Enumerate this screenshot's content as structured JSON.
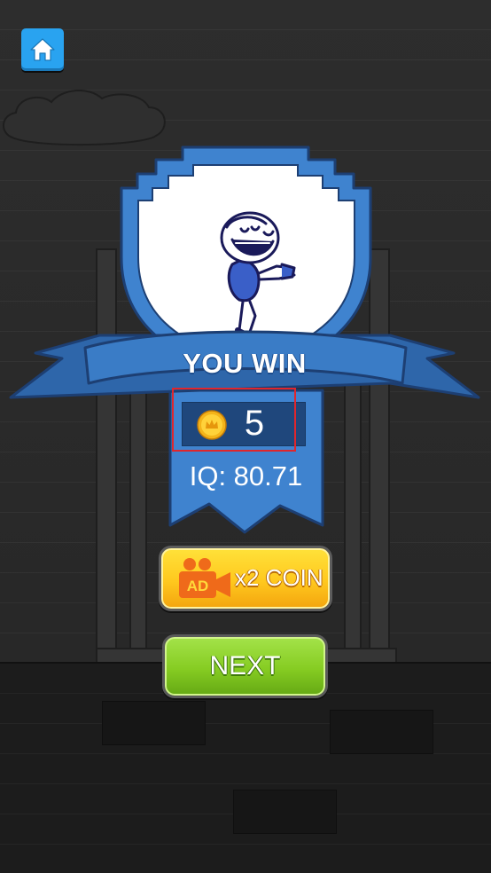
{
  "result": {
    "title": "YOU WIN",
    "coins_earned": "5",
    "iq_label": "IQ: 80.71"
  },
  "buttons": {
    "home_icon": "home-icon",
    "ad_badge": "AD",
    "ad_reward_label": "x2 COIN",
    "next_label": "NEXT"
  },
  "colors": {
    "badge_blue": "#3f83cf",
    "ribbon_blue": "#3a7cc6",
    "coin_box": "#1f477c",
    "ad_button_yellow": "#ffd22a",
    "next_button_green": "#8ad02a",
    "highlight_red": "#e0262c"
  }
}
